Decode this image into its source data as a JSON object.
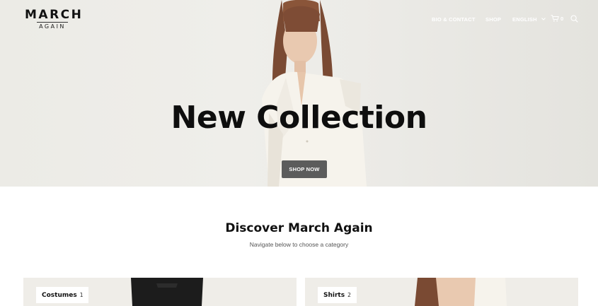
{
  "logo": {
    "main": "MARCH",
    "sub": "AGAIN"
  },
  "nav": {
    "items": [
      "BIO & CONTACT",
      "SHOP",
      "ENGLISH"
    ],
    "cart_count": "0",
    "icons": [
      "chevron-down-icon",
      "cart-icon",
      "search-icon"
    ]
  },
  "hero": {
    "title": "New Collection",
    "button": "SHOP NOW"
  },
  "section": {
    "title": "Discover March Again",
    "subtitle": "Navigate below to choose a category"
  },
  "categories": [
    {
      "label": "Costumes",
      "count": "1"
    },
    {
      "label": "Shirts",
      "count": "2"
    }
  ],
  "colors": {
    "hero_bg": "#ecebe6",
    "button_bg": "#5c5c5c",
    "card_bg": "#efede8",
    "text": "#111111"
  }
}
